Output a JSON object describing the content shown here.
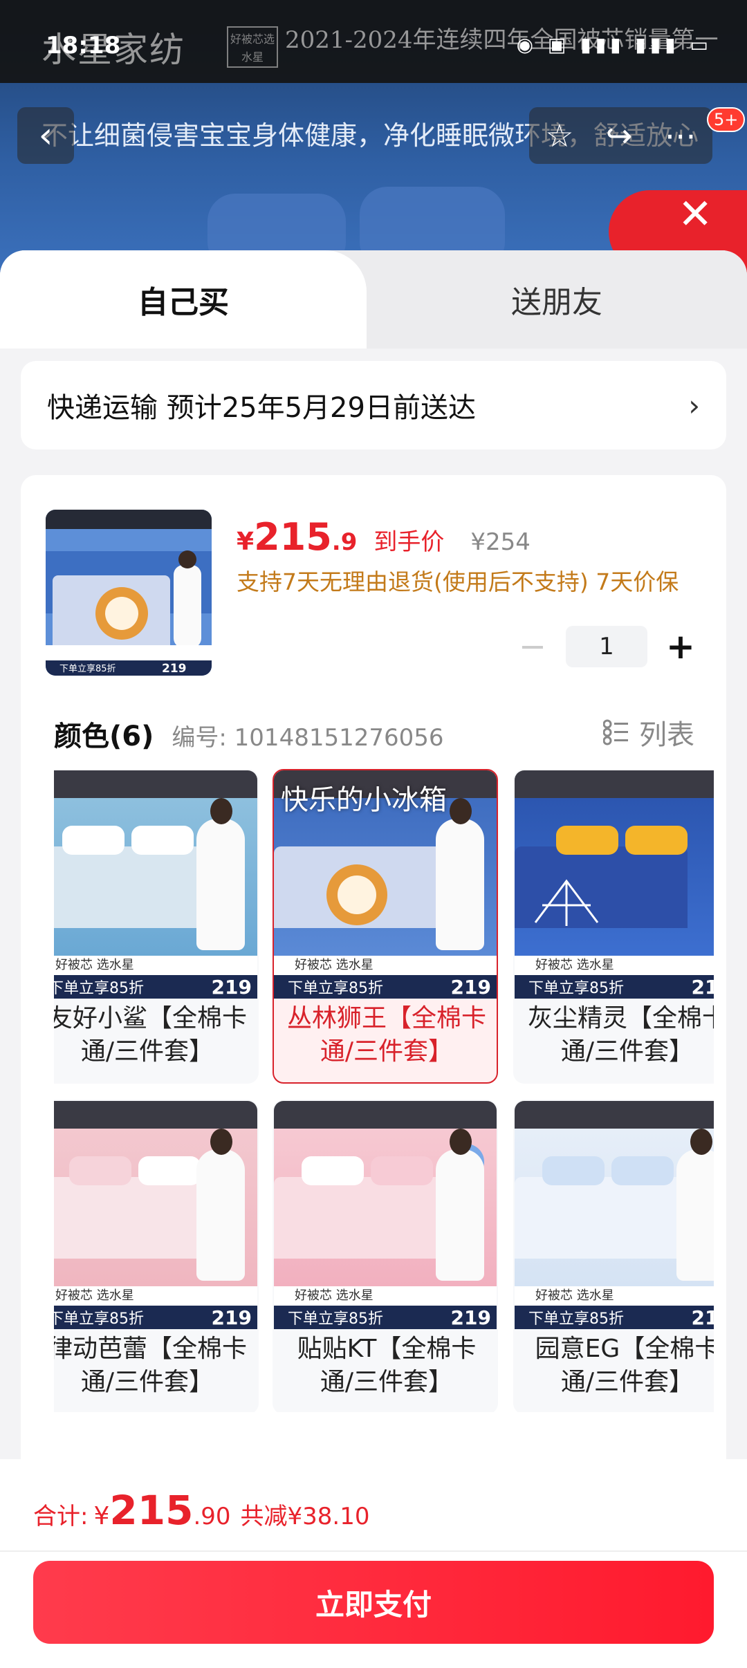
{
  "status_bar": {
    "time": "18:18"
  },
  "banner": {
    "brand": "水星家纺",
    "seal": "好被芯选水星",
    "slogan": "2021-2024年连续四年全国被芯销量第一",
    "sub_slogan": "不让细菌侵害宝宝身体健康，净化睡眠微环境，舒适放心",
    "badge": "5+"
  },
  "tabs": {
    "self": "自己买",
    "friend": "送朋友"
  },
  "delivery": {
    "text": "快递运输 预计25年5月29日前送达"
  },
  "product": {
    "price_symbol": "¥",
    "price_int": "215",
    "price_dec": ".9",
    "price_label": "到手价",
    "original_price": "¥254",
    "guarantee": "支持7天无理由退货(使用后不支持) 7天价保",
    "quantity": "1"
  },
  "color_section": {
    "title": "颜色",
    "count": "(6)",
    "sku": "编号: 10148151276056",
    "list_label": "列表",
    "overlay": "快乐的小冰箱",
    "thumb_strip": "下单立享85折",
    "thumb_price": "219",
    "thumb_sub": "好被芯 选水星",
    "variants": [
      {
        "name": "友好小鲨【全棉卡通/三件套】",
        "line1": "友好小鲨【全棉卡",
        "line2": "通/三件套】",
        "selected": false
      },
      {
        "name": "丛林狮王【全棉卡通/三件套】",
        "line1": "丛林狮王【全棉卡",
        "line2": "通/三件套】",
        "selected": true
      },
      {
        "name": "灰尘精灵【全棉卡通/三件套】",
        "line1": "灰尘精灵【全棉卡",
        "line2": "通/三件套】",
        "selected": false
      },
      {
        "name": "律动芭蕾【全棉卡通/三件套】",
        "line1": "律动芭蕾【全棉卡",
        "line2": "通/三件套】",
        "selected": false
      },
      {
        "name": "贴贴KT【全棉卡通/三件套】",
        "line1": "贴贴KT【全棉卡",
        "line2": "通/三件套】",
        "selected": false
      },
      {
        "name": "园意EG【全棉卡通/三件套】",
        "line1": "园意EG【全棉卡",
        "line2": "通/三件套】",
        "selected": false
      }
    ]
  },
  "footer": {
    "total_label": "合计:",
    "total_symbol": "¥",
    "total_int": "215",
    "total_dec": ".90",
    "saving": "共减¥38.10",
    "pay_button": "立即支付"
  },
  "colors": {
    "accent": "#e8222b",
    "guarantee": "#c37a1a",
    "selected_bg": "#fff0f1"
  }
}
